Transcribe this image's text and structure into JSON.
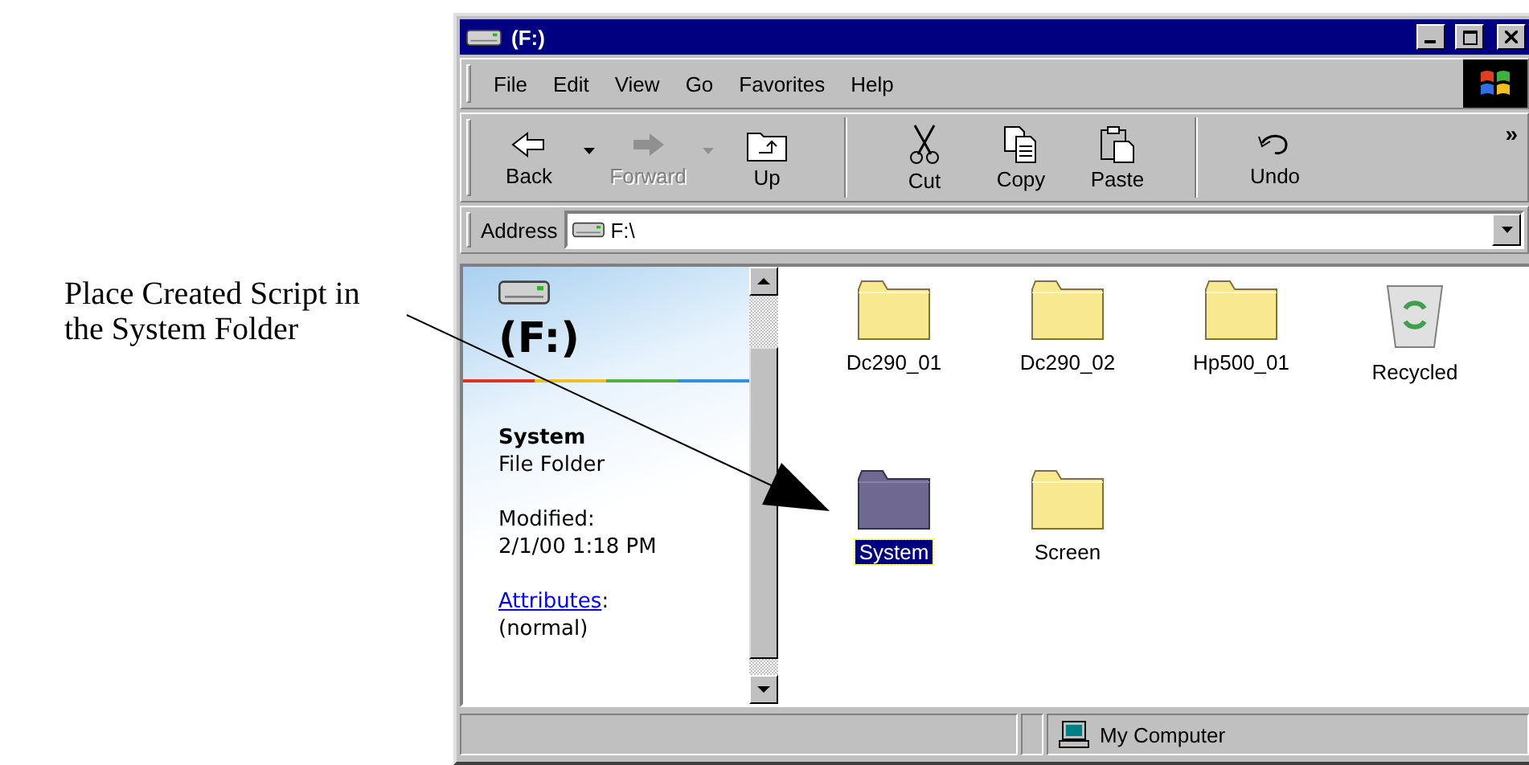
{
  "callout": {
    "text": "Place Created Script in the System Folder"
  },
  "window": {
    "title": "(F:)"
  },
  "menu": [
    "File",
    "Edit",
    "View",
    "Go",
    "Favorites",
    "Help"
  ],
  "toolbar": {
    "groups": [
      [
        {
          "label": "Back",
          "kind": "back",
          "dropdown": true,
          "disabled": false
        },
        {
          "label": "Forward",
          "kind": "forward",
          "dropdown": true,
          "disabled": true
        },
        {
          "label": "Up",
          "kind": "up",
          "dropdown": false,
          "disabled": false
        }
      ],
      [
        {
          "label": "Cut",
          "kind": "cut",
          "dropdown": false,
          "disabled": false
        },
        {
          "label": "Copy",
          "kind": "copy",
          "dropdown": false,
          "disabled": false
        },
        {
          "label": "Paste",
          "kind": "paste",
          "dropdown": false,
          "disabled": false
        }
      ],
      [
        {
          "label": "Undo",
          "kind": "undo",
          "dropdown": false,
          "disabled": false
        }
      ]
    ],
    "more": "»"
  },
  "address": {
    "label": "Address",
    "value": "F:\\"
  },
  "info_pane": {
    "drive": "(F:)",
    "name": "System",
    "type": "File Folder",
    "modified_label": "Modified:",
    "modified": "2/1/00 1:18 PM",
    "attributes_link": "Attributes",
    "attributes_suffix": ":",
    "attributes": "(normal)"
  },
  "items": [
    {
      "label": "Dc290_01",
      "kind": "folder",
      "selected": false
    },
    {
      "label": "Dc290_02",
      "kind": "folder",
      "selected": false
    },
    {
      "label": "Hp500_01",
      "kind": "folder",
      "selected": false
    },
    {
      "label": "Recycled",
      "kind": "recycle",
      "selected": false
    },
    {
      "label": "System",
      "kind": "folder",
      "selected": true
    },
    {
      "label": "Screen",
      "kind": "folder",
      "selected": false
    }
  ],
  "status_bar": {
    "zone": "My Computer"
  }
}
